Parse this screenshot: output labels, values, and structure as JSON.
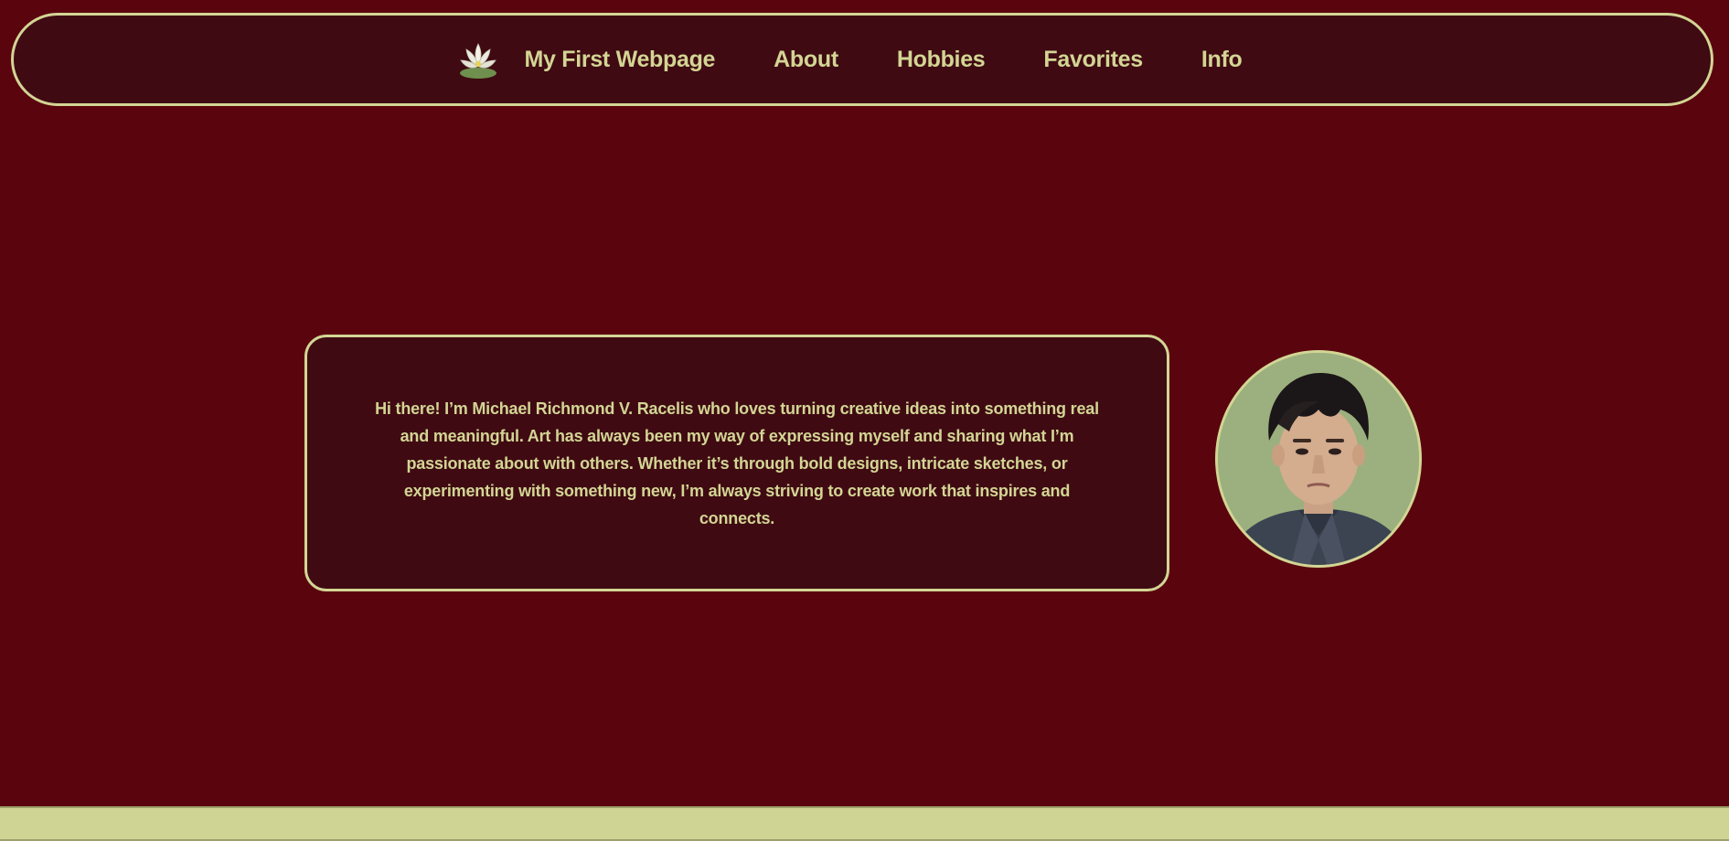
{
  "nav": {
    "logo_icon": "water-lily-icon",
    "title": "My First Webpage",
    "links": [
      "About",
      "Hobbies",
      "Favorites",
      "Info"
    ]
  },
  "intro": {
    "text": "Hi there! I’m Michael Richmond V. Racelis who loves turning creative ideas into something real and meaningful. Art has always been my way of expressing myself and sharing what I’m passionate about with others. Whether it’s through bold designs, intricate sketches, or experimenting with something new, I’m always striving to create work that inspires and connects."
  },
  "profile": {
    "image": "profile-photo"
  },
  "colors": {
    "background": "#5a040e",
    "panel": "#3f0a12",
    "accent": "#d3d594",
    "footer": "#cfd494"
  }
}
